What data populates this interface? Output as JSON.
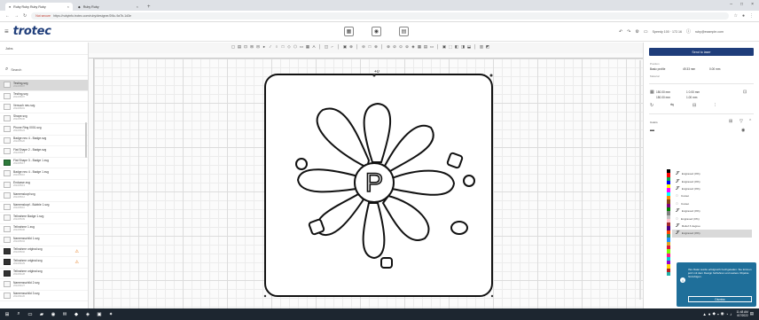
{
  "browser": {
    "tabs": [
      {
        "label": "Ruby Ruby Ruby Ruby",
        "active": true
      },
      {
        "label": "Ruby Ruby",
        "active": false
      }
    ],
    "new_tab": "+",
    "address": {
      "warning": "Not secure",
      "url": "https://rubyinfo.trotec.com/ruby/designer/2f4c-9a7b-1d3e"
    }
  },
  "app": {
    "logo": "trotec",
    "header_right": {
      "device": "Speedy 100 · 172.16",
      "account": "ruby@example.com"
    }
  },
  "sidebar": {
    "title": "Jobs",
    "search_placeholder": "Search",
    "jobs": [
      {
        "name": "Testing.svg",
        "date": "2022/06/07",
        "thumb": "light",
        "selected": true,
        "alert": false
      },
      {
        "name": "Testing.svg",
        "date": "2022/06/07",
        "thumb": "light",
        "selected": false,
        "alert": false
      },
      {
        "name": "Versuch neu.svg",
        "date": "2022/06/01",
        "thumb": "light",
        "selected": false,
        "alert": false
      },
      {
        "name": "Shape.svg",
        "date": "2022/05/30",
        "thumb": "light",
        "selected": false,
        "alert": false
      },
      {
        "name": "Phone Ring 0001.svg",
        "date": "2022/05/24",
        "thumb": "light",
        "selected": false,
        "alert": false
      },
      {
        "name": "Badge neu 4 - Badge.svg",
        "date": "2022/05/20",
        "thumb": "light",
        "selected": false,
        "alert": false
      },
      {
        "name": "Flat Shape 2 - Badge.svg",
        "date": "2022/05/17",
        "thumb": "light",
        "selected": false,
        "alert": false
      },
      {
        "name": "Flat Shape 3 - Badge 1.svg",
        "date": "2022/05/17",
        "thumb": "green",
        "selected": false,
        "alert": false
      },
      {
        "name": "Badge neu 4 - Badge 1.svg",
        "date": "2022/05/16",
        "thumb": "light",
        "selected": false,
        "alert": false
      },
      {
        "name": "Endcase.svg",
        "date": "2022/05/13",
        "thumb": "light",
        "selected": false,
        "alert": false
      },
      {
        "name": "Namenskopf.svg",
        "date": "2022/05/12",
        "thumb": "light",
        "selected": false,
        "alert": false
      },
      {
        "name": "Namenskopf - Bubble 1.svg",
        "date": "2022/05/10",
        "thumb": "light",
        "selected": false,
        "alert": false
      },
      {
        "name": "Teilnahme Badge 1.svg",
        "date": "2022/05/09",
        "thumb": "light",
        "selected": false,
        "alert": false
      },
      {
        "name": "Teilnahme 1.svg",
        "date": "2022/05/06",
        "thumb": "light",
        "selected": false,
        "alert": false
      },
      {
        "name": "Namensschild 1.svg",
        "date": "2022/05/04",
        "thumb": "light",
        "selected": false,
        "alert": false
      },
      {
        "name": "Teilnahme original.svg",
        "date": "2022/05/02",
        "thumb": "dark",
        "selected": false,
        "alert": true
      },
      {
        "name": "Teilnahme original.svg",
        "date": "2022/04/29",
        "thumb": "dark",
        "selected": false,
        "alert": true
      },
      {
        "name": "Teilnahme original.svg",
        "date": "2022/04/28",
        "thumb": "dark",
        "selected": false,
        "alert": false
      },
      {
        "name": "Namensschild 2.svg",
        "date": "2022/04/27",
        "thumb": "light",
        "selected": false,
        "alert": false
      },
      {
        "name": "Namensschild 3.svg",
        "date": "2022/04/26",
        "thumb": "light",
        "selected": false,
        "alert": false
      }
    ]
  },
  "canvas": {
    "toolbar_glyphs": [
      "▢",
      "▤",
      "⊡",
      "⊞",
      "⊟",
      "▸",
      "⁄",
      "○",
      "□",
      "◇",
      "⬡",
      "▭",
      "▦",
      "A",
      "│",
      "◫",
      "⌐",
      "│",
      "▣",
      "⊕",
      "│",
      "⊖",
      "□",
      "⊕",
      "│",
      "⊗",
      "⊘",
      "⊙",
      "⊚",
      "◈",
      "▦",
      "▤",
      "▭",
      "│",
      "▣",
      "⬚",
      "◧",
      "◨",
      "⬓",
      "│",
      "▥",
      "◩"
    ],
    "design_letter": "P",
    "size_marker": "+0"
  },
  "right_panel": {
    "laser_button": "Send to laser",
    "position_label": "Position",
    "material_label": "Material",
    "material_value": "Basic profile",
    "x_label": "X",
    "x_value": "49.33 mm",
    "y_value": "0.00 mm",
    "size_w": "1 0.00 mm",
    "size_h": "1.00 mm",
    "width_value": "150.00 mm",
    "height_value": "150.00 mm",
    "colors_label": "Colors",
    "layers": [
      {
        "icon": "𝒮",
        "label": "Engraved (0%)"
      },
      {
        "icon": "𝒮",
        "label": "Engraved (0%)"
      },
      {
        "icon": "𝒮",
        "label": "Engraved (0%)"
      },
      {
        "icon": "◌",
        "label": "Cutout"
      },
      {
        "icon": "◌",
        "label": "Cutout"
      },
      {
        "icon": "𝒮",
        "label": "Engraved (0%)"
      },
      {
        "icon": "◌",
        "label": "Engraved (0%)"
      },
      {
        "icon": "𝒮",
        "label": "Relief 3 degree"
      },
      {
        "icon": "𝒮",
        "label": "Engraved (0%)"
      }
    ],
    "palette": [
      "#000000",
      "#ff0000",
      "#00a651",
      "#0000ff",
      "#ffff00",
      "#ff00ff",
      "#00ffff",
      "#ff8c00",
      "#8b4513",
      "#800080",
      "#008000",
      "#808080",
      "#c0c0c0",
      "#ffc0cb",
      "#a52a2a",
      "#4b0082",
      "#ff4500",
      "#2e8b57",
      "#1e90ff",
      "#daa520",
      "#dc143c",
      "#7fff00",
      "#ff1493",
      "#00ced1",
      "#9400d3",
      "#ffd700",
      "#b22222",
      "#20b2aa"
    ],
    "toast": {
      "message": "Ihre Datei wurde erfolgreich hochgeladen. Sie können jetzt mit dem Design fortfahren und weitere Objekte hinzufügen.",
      "button": "Dismiss"
    }
  },
  "taskbar": {
    "clock_time": "11:48 AM",
    "clock_date": "6/7/2022"
  }
}
